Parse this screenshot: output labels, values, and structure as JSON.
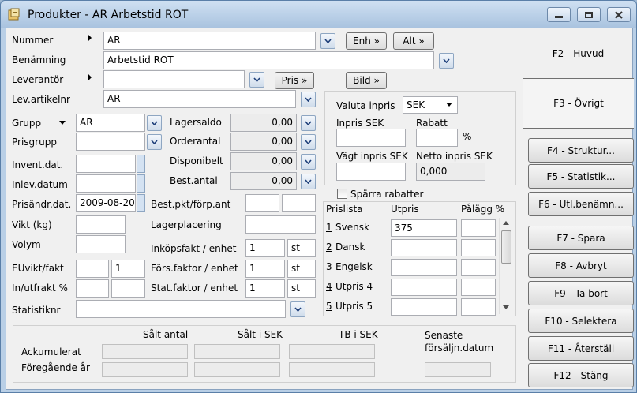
{
  "window": {
    "title": "Produkter - AR Arbetstid ROT"
  },
  "form": {
    "nummer": {
      "label": "Nummer",
      "value": "AR"
    },
    "benamning": {
      "label": "Benämning",
      "value": "Arbetstid ROT"
    },
    "leverantor": {
      "label": "Leverantör",
      "value": ""
    },
    "lev_artikelnr": {
      "label": "Lev.artikelnr",
      "value": "AR"
    },
    "grupp": {
      "label": "Grupp",
      "value": "AR"
    },
    "prisgrupp": {
      "label": "Prisgrupp",
      "value": ""
    },
    "invent_dat": {
      "label": "Invent.dat.",
      "value": ""
    },
    "inlev_datum": {
      "label": "Inlev.datum",
      "value": ""
    },
    "prisandr_dat": {
      "label": "Prisändr.dat.",
      "value": "2009-08-20"
    },
    "vikt": {
      "label": "Vikt (kg)",
      "value": ""
    },
    "volym": {
      "label": "Volym",
      "value": ""
    },
    "euvikt_fakt": {
      "label": "EUvikt/fakt",
      "value": "",
      "fakt": "1"
    },
    "in_utfrakt": {
      "label": "In/utfrakt %"
    },
    "statistiknr": {
      "label": "Statistiknr",
      "value": ""
    },
    "lagersaldo": {
      "label": "Lagersaldo",
      "value": "0,00"
    },
    "orderantal": {
      "label": "Orderantal",
      "value": "0,00"
    },
    "disponibelt": {
      "label": "Disponibelt",
      "value": "0,00"
    },
    "best_antal": {
      "label": "Best.antal",
      "value": "0,00"
    },
    "best_pkt": {
      "label": "Best.pkt/förp.ant"
    },
    "lagerplacering": {
      "label": "Lagerplacering",
      "value": ""
    },
    "inkopsfakt": {
      "label": "Inköpsfakt / enhet",
      "value": "1",
      "unit": "st"
    },
    "forsfaktor": {
      "label": "Förs.faktor / enhet",
      "value": "1",
      "unit": "st"
    },
    "statfaktor": {
      "label": "Stat.faktor / enhet",
      "value": "1",
      "unit": "st"
    }
  },
  "buttons": {
    "enh": "Enh",
    "alt": "Alt",
    "pris": "Pris",
    "bild": "Bild"
  },
  "pricing": {
    "valuta_label": "Valuta inpris",
    "valuta": "SEK",
    "inpris_label": "Inpris SEK",
    "rabatt_label": "Rabatt",
    "pct": "%",
    "vagt_label": "Vägt inpris SEK",
    "netto_label": "Netto inpris SEK",
    "netto": "0,000",
    "sparra_label": "Spärra rabatter",
    "headers": [
      "Prislista",
      "Utpris",
      "Pålägg %"
    ],
    "rows": [
      {
        "num": "1",
        "name": "Svensk",
        "utpris": "375",
        "palagg": ""
      },
      {
        "num": "2",
        "name": "Dansk",
        "utpris": "",
        "palagg": ""
      },
      {
        "num": "3",
        "name": "Engelsk",
        "utpris": "",
        "palagg": ""
      },
      {
        "num": "4",
        "name": "Utpris 4",
        "utpris": "",
        "palagg": ""
      },
      {
        "num": "5",
        "name": "Utpris 5",
        "utpris": "",
        "palagg": ""
      }
    ]
  },
  "stats": {
    "headers": [
      "Sålt antal",
      "Sålt i SEK",
      "TB i SEK",
      "Senaste försäljn.datum"
    ],
    "ackumulerat": "Ackumulerat",
    "foregaende": "Föregående år"
  },
  "fkeys": [
    "F2 - Huvud",
    "F3 - Övrigt",
    "F4 - Struktur...",
    "F5 - Statistik...",
    "F6 - Utl.benämn...",
    "F7 - Spara",
    "F8 - Avbryt",
    "F9 - Ta bort",
    "F10 - Selektera",
    "F11 - Återställ",
    "F12 - Stäng"
  ]
}
